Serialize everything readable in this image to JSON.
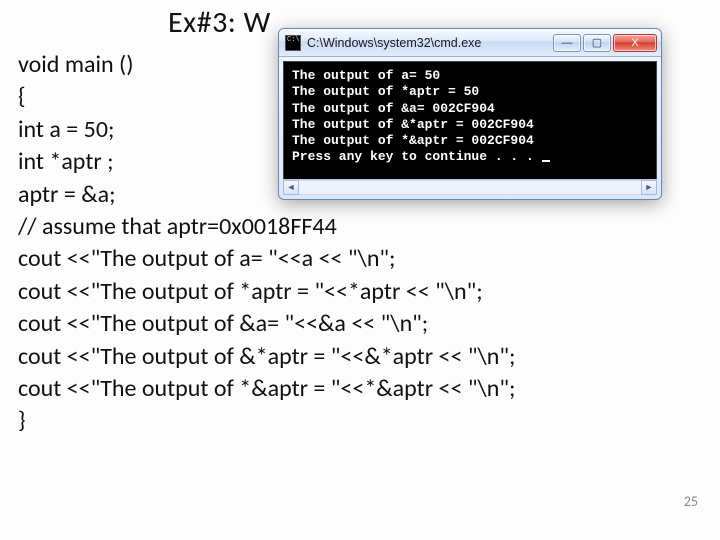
{
  "heading": "Ex#3: W",
  "code_lines": [
    "void main ()",
    "{",
    "int a = 50;",
    "int *aptr ;",
    "aptr = &a;",
    "// assume that aptr=0x0018FF44",
    "cout <<\"The output of a= \"<<a << \"\\n\";",
    "cout <<\"The output of *aptr = \"<<*aptr << \"\\n\";",
    "cout <<\"The output of &a= \"<<&a << \"\\n\";",
    "cout <<\"The output of &*aptr = \"<<&*aptr << \"\\n\";",
    "cout <<\"The output of *&aptr = \"<<*&aptr << \"\\n\";",
    "}"
  ],
  "page_number": "25",
  "cmd": {
    "title": "C:\\Windows\\system32\\cmd.exe",
    "output_lines": [
      "The output of a= 50",
      "The output of *aptr = 50",
      "The output of &a= 002CF904",
      "The output of &*aptr = 002CF904",
      "The output of *&aptr = 002CF904",
      "Press any key to continue . . ."
    ],
    "buttons": {
      "min": "—",
      "max": "▢",
      "close": "X"
    },
    "scroll": {
      "left": "◄",
      "right": "►"
    }
  }
}
